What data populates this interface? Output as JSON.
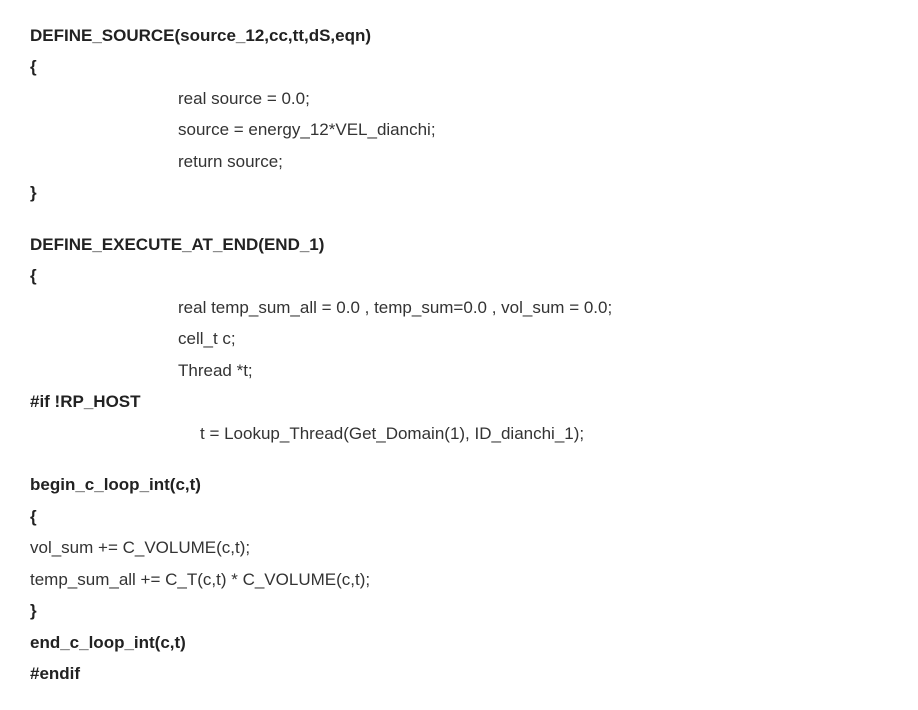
{
  "lines": {
    "l1": "DEFINE_SOURCE(source_12,cc,tt,dS,eqn)",
    "l2": "{",
    "l3": "real source = 0.0;",
    "l4": "source = energy_12*VEL_dianchi;",
    "l5": "return source;",
    "l6": "}",
    "l7": "DEFINE_EXECUTE_AT_END(END_1)",
    "l8": "{",
    "l9": "real temp_sum_all = 0.0 , temp_sum=0.0 , vol_sum = 0.0;",
    "l10": "cell_t c;",
    "l11": "Thread *t;",
    "l12": "#if !RP_HOST",
    "l13": "t = Lookup_Thread(Get_Domain(1), ID_dianchi_1);",
    "l14": "begin_c_loop_int(c,t)",
    "l15": "{",
    "l16": "vol_sum += C_VOLUME(c,t);",
    "l17": "temp_sum_all += C_T(c,t) * C_VOLUME(c,t);",
    "l18": "}",
    "l19": "end_c_loop_int(c,t)",
    "l20": "#endif"
  }
}
